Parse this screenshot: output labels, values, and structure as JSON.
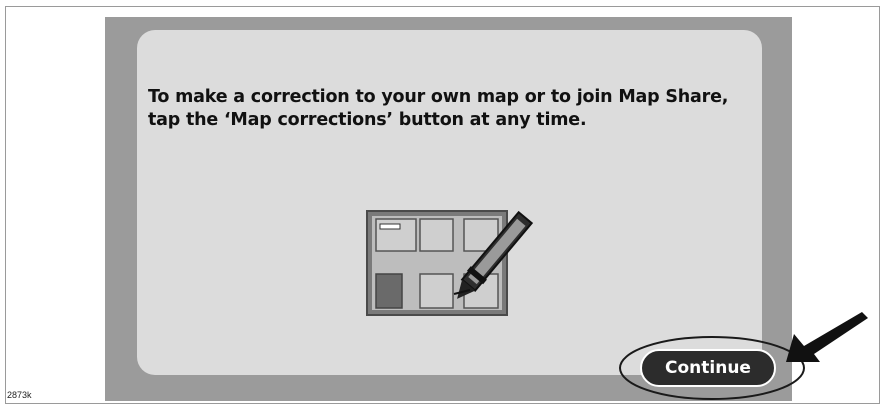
{
  "dialog": {
    "line1": "To make a correction to your own map or to join Map Share,",
    "line2": "tap the ‘Map corrections’ button at any time."
  },
  "illustration": {
    "icon": "map-corrections-icon"
  },
  "continue_button": {
    "label": "Continue"
  },
  "annotations": {
    "figure_id": "2873k"
  },
  "colors": {
    "screen_border": "#9b9b9b",
    "panel": "#dcdcdc",
    "button": "#2c2c2c",
    "button_text": "#ffffff"
  }
}
